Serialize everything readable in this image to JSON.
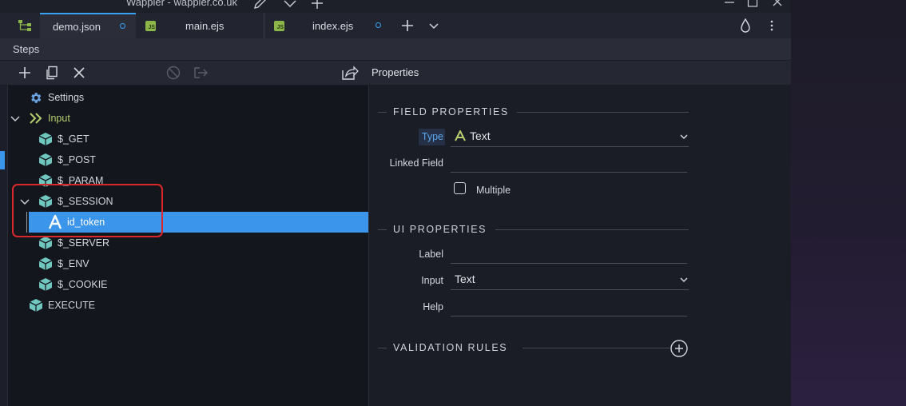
{
  "window": {
    "title": "Wappler - wappler.co.uk"
  },
  "tabs": [
    {
      "label": "demo.json",
      "badge": "",
      "active": true
    },
    {
      "label": "main.ejs",
      "badge": "JS",
      "active": false
    },
    {
      "label": "index.ejs",
      "badge": "JS",
      "active": false
    }
  ],
  "panel": {
    "title": "Steps"
  },
  "toolbar": {
    "icons": [
      "add-icon",
      "copy-icon",
      "delete-icon",
      "disable-icon",
      "export-icon",
      "properties-export-icon"
    ],
    "properties_title": "Properties"
  },
  "tree": {
    "items": [
      {
        "label": "Settings",
        "icon": "gear-icon"
      },
      {
        "label": "Input",
        "icon": "double-chevron-icon"
      },
      {
        "label": "$_GET",
        "icon": "cube-icon"
      },
      {
        "label": "$_POST",
        "icon": "cube-icon"
      },
      {
        "label": "$_PARAM",
        "icon": "cube-icon"
      },
      {
        "label": "$_SESSION",
        "icon": "cube-icon"
      },
      {
        "label": "id_token",
        "icon": "text-a-icon",
        "selected": true
      },
      {
        "label": "$_SERVER",
        "icon": "cube-icon"
      },
      {
        "label": "$_ENV",
        "icon": "cube-icon"
      },
      {
        "label": "$_COOKIE",
        "icon": "cube-icon"
      },
      {
        "label": "EXECUTE",
        "icon": "cube-icon"
      }
    ]
  },
  "properties": {
    "field_section": "FIELD PROPERTIES",
    "type_label": "Type",
    "type_value": "Text",
    "linked_field_label": "Linked Field",
    "linked_field_value": "",
    "multiple_label": "Multiple",
    "ui_section": "UI PROPERTIES",
    "label_label": "Label",
    "label_value": "",
    "input_label": "Input",
    "input_value": "Text",
    "help_label": "Help",
    "help_value": "",
    "validation_section": "VALIDATION RULES"
  },
  "colors": {
    "accent": "#3b95ea",
    "input_green": "#b5cf6e",
    "cube": "#6fc7c0",
    "annotation_red": "#d9282c"
  }
}
